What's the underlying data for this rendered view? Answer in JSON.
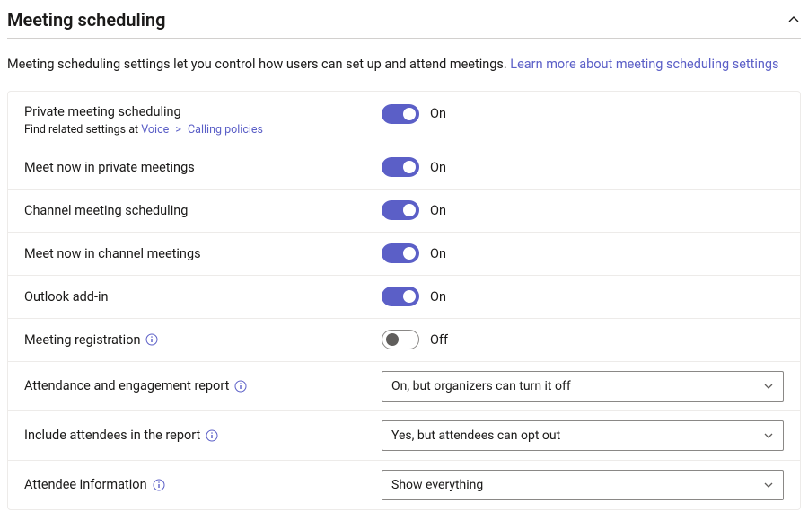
{
  "section": {
    "title": "Meeting scheduling"
  },
  "description": {
    "text": "Meeting scheduling settings let you control how users can set up and attend meetings. ",
    "link_text": "Learn more about meeting scheduling settings"
  },
  "related": {
    "prefix": "Find related settings at ",
    "part1": "Voice",
    "sep": ">",
    "part2": "Calling policies"
  },
  "settings": {
    "private_meeting_scheduling": {
      "label": "Private meeting scheduling",
      "value": "On",
      "on": true
    },
    "meet_now_private": {
      "label": "Meet now in private meetings",
      "value": "On",
      "on": true
    },
    "channel_meeting_scheduling": {
      "label": "Channel meeting scheduling",
      "value": "On",
      "on": true
    },
    "meet_now_channel": {
      "label": "Meet now in channel meetings",
      "value": "On",
      "on": true
    },
    "outlook_addin": {
      "label": "Outlook add-in",
      "value": "On",
      "on": true
    },
    "meeting_registration": {
      "label": "Meeting registration",
      "value": "Off",
      "on": false
    },
    "attendance_report": {
      "label": "Attendance and engagement report",
      "value": "On, but organizers can turn it off"
    },
    "include_attendees": {
      "label": "Include attendees in the report",
      "value": "Yes, but attendees can opt out"
    },
    "attendee_information": {
      "label": "Attendee information",
      "value": "Show everything"
    }
  },
  "colors": {
    "accent": "#5b5fc7",
    "link": "#5b5fc7",
    "border": "#edebe9"
  }
}
